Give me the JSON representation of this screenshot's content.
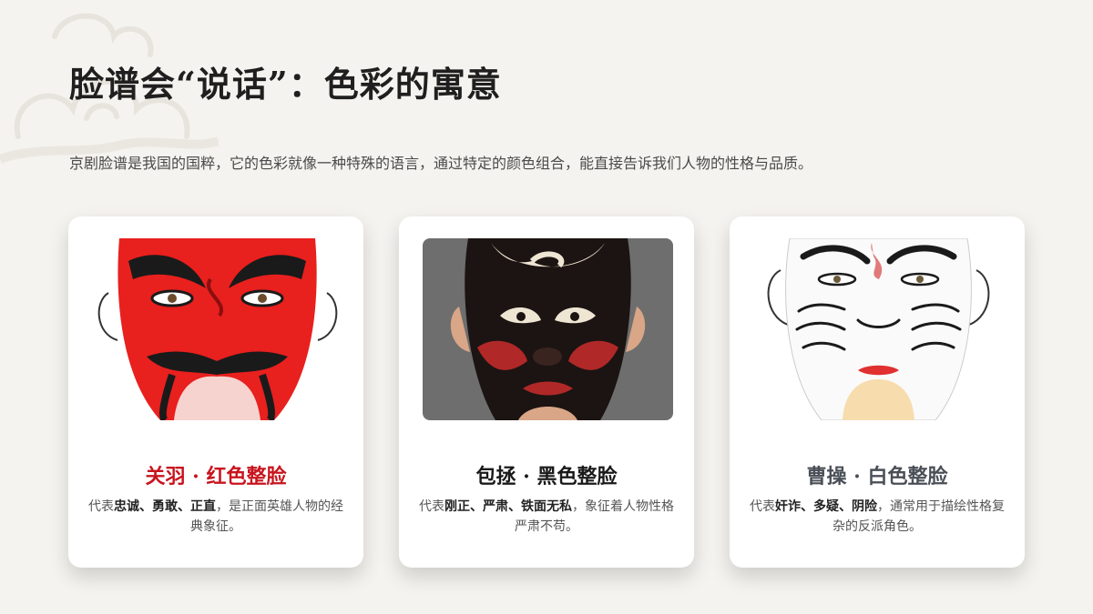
{
  "page": {
    "title": "脸谱会“说话”：色彩的寓意",
    "intro": "京剧脸谱是我国的国粹，它的色彩就像一种特殊的语言，通过特定的颜色组合，能直接告诉我们人物的性格与品质。"
  },
  "cards": [
    {
      "title": "关羽 · 红色整脸",
      "title_color": "#c8141e",
      "desc_pre": "代表",
      "desc_bold": "忠诚、勇敢、正直",
      "desc_post": "，是正面英雄人物的经典象征。",
      "mask": "red-mask-icon"
    },
    {
      "title": "包拯 · 黑色整脸",
      "title_color": "#1a1a1a",
      "desc_pre": "代表",
      "desc_bold": "刚正、严肃、铁面无私",
      "desc_post": "，象征着人物性格严肃不苟。",
      "mask": "black-mask-icon"
    },
    {
      "title": "曹操 · 白色整脸",
      "title_color": "#4a4f57",
      "desc_pre": "代表",
      "desc_bold": "奸诈、多疑、阴险",
      "desc_post": "，通常用于描绘性格复杂的反派角色。",
      "mask": "white-mask-icon"
    }
  ]
}
